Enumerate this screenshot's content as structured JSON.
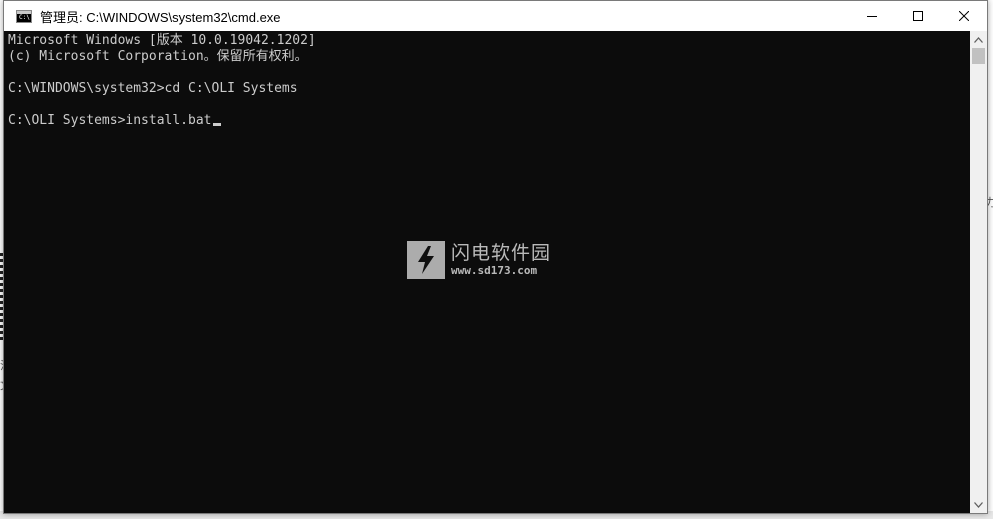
{
  "window": {
    "title": "管理员: C:\\WINDOWS\\system32\\cmd.exe",
    "icon_label": "C:\\",
    "controls": [
      "minimize-icon",
      "maximize-icon",
      "close-icon"
    ]
  },
  "console": {
    "lines": [
      "Microsoft Windows [版本 10.0.19042.1202]",
      "(c) Microsoft Corporation。保留所有权利。",
      "",
      "C:\\WINDOWS\\system32>cd C:\\OLI Systems",
      "",
      "C:\\OLI Systems>install.bat"
    ]
  },
  "watermark": {
    "name": "闪电软件园",
    "url": "www.sd173.com"
  },
  "background": {
    "left_glyphs": [
      "況",
      "文"
    ],
    "right_glyph": "力"
  },
  "colors": {
    "console_bg": "#0c0c0c",
    "console_fg": "#cccccc",
    "titlebar_bg": "#ffffff"
  }
}
